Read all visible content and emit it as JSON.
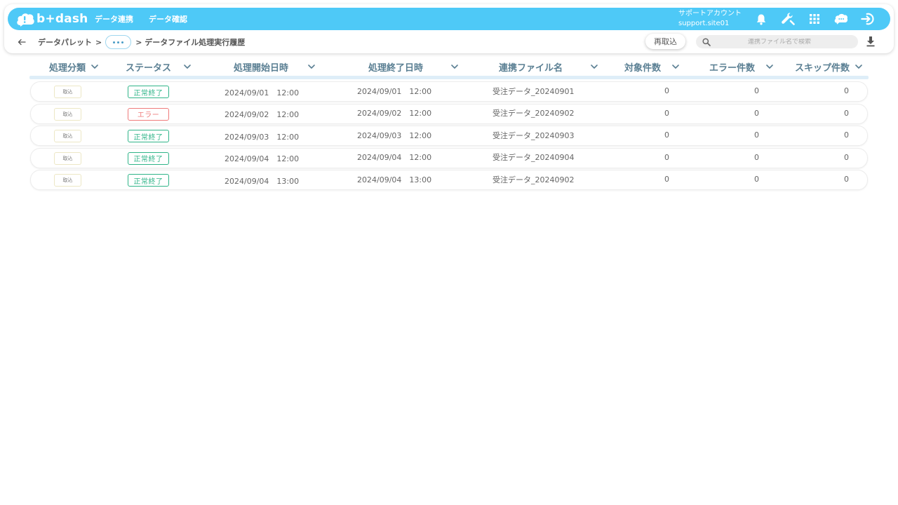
{
  "app": {
    "logo_text": "b+dash",
    "brand_color": "#4ec9f7"
  },
  "nav": {
    "links": [
      "データ連携",
      "データ確認"
    ],
    "account_name": "サポートアカウント",
    "account_id": "support.site01",
    "icons": [
      "bell-icon",
      "wrench-icon",
      "grid-icon",
      "chat-icon",
      "logout-icon"
    ]
  },
  "breadcrumb": {
    "home": "データパレット",
    "separator": ">",
    "current": "> データファイル処理実行履歴"
  },
  "toolbar": {
    "reload_label": "再取込",
    "search_placeholder": "連携ファイル名で検索"
  },
  "table": {
    "headers": [
      "処理分類",
      "ステータス",
      "処理開始日時",
      "処理終了日時",
      "連携ファイル名",
      "対象件数",
      "エラー件数",
      "スキップ件数"
    ],
    "rows": [
      {
        "type": "取込",
        "status": "正常終了",
        "status_color": "#2fb488",
        "start": "2024/09/01　12:00",
        "end": "2024/09/01　12:00",
        "file": "受注データ_20240901",
        "target": "0",
        "error": "0",
        "skip": "0"
      },
      {
        "type": "取込",
        "status": "エラー",
        "status_color": "#ef7b7b",
        "start": "2024/09/02　12:00",
        "end": "2024/09/02　12:00",
        "file": "受注データ_20240902",
        "target": "0",
        "error": "0",
        "skip": "0"
      },
      {
        "type": "取込",
        "status": "正常終了",
        "status_color": "#2fb488",
        "start": "2024/09/03　12:00",
        "end": "2024/09/03　12:00",
        "file": "受注データ_20240903",
        "target": "0",
        "error": "0",
        "skip": "0"
      },
      {
        "type": "取込",
        "status": "正常終了",
        "status_color": "#2fb488",
        "start": "2024/09/04　12:00",
        "end": "2024/09/04　12:00",
        "file": "受注データ_20240904",
        "target": "0",
        "error": "0",
        "skip": "0"
      },
      {
        "type": "取込",
        "status": "正常終了",
        "status_color": "#2fb488",
        "start": "2024/09/04　13:00",
        "end": "2024/09/04　13:00",
        "file": "受注データ_20240902",
        "target": "0",
        "error": "0",
        "skip": "0"
      }
    ]
  }
}
